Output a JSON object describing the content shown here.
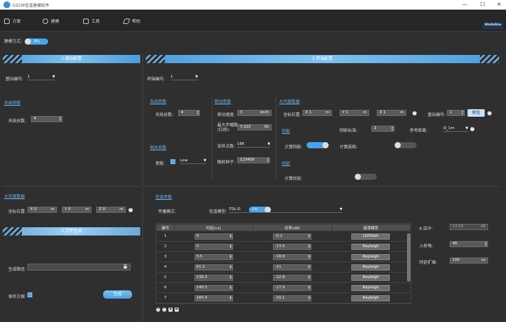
{
  "app": {
    "title": "GSCM信道建模软件"
  },
  "menu": {
    "items": [
      {
        "label": "方案",
        "icon": "document-icon"
      },
      {
        "label": "建模",
        "icon": "model-icon"
      },
      {
        "label": "工具",
        "icon": "toolbox-icon"
      },
      {
        "label": "帮助",
        "icon": "send-icon"
      }
    ],
    "brand": "Statistica"
  },
  "mode": {
    "label": "建模方式:",
    "toggle_text": "默认"
  },
  "base": {
    "header": "1.基站配置",
    "station_label": "基站编号:",
    "station_value": "1",
    "antenna_section": "天线参数",
    "antenna_count_label": "天线总数:",
    "antenna_count_value": "4",
    "scale_section": "大尺度数据",
    "coord_label": "坐标位置:",
    "x_prefix": "X",
    "x_value": "0",
    "y_prefix": "Y",
    "y_value": "0",
    "z_prefix": "Z",
    "z_value": "0",
    "unit_m": "m"
  },
  "terminal": {
    "header": "2.终端配置",
    "terminal_label": "终端编号:",
    "terminal_value": "1",
    "antenna_section": "天线参数",
    "antenna_count_label": "天线总数:",
    "antenna_count_value": "4",
    "corr_section": "相关系数",
    "corr_label": "使能:",
    "corr_level": "Low",
    "move_section": "移动参数",
    "speed_label": "移动速度:",
    "speed_value": "3",
    "speed_unit": "km/h",
    "step_label": "最大步幅数 (位移):",
    "step_value": "7.222",
    "step_unit": "Hz",
    "sample_label": "采样点数:",
    "sample_value": "16K",
    "seed_label": "随机种子:",
    "seed_value": "123456",
    "scale_section": "大尺度数据",
    "coord_label": "坐标位置:",
    "x_prefix": "X",
    "x_value": "1",
    "y_prefix": "Y",
    "y_value": "1",
    "z_prefix": "Z",
    "z_value": "1",
    "unit_m": "m",
    "base_no_label": "基站编号:",
    "base_no_value": "1",
    "preview_button": "预览",
    "shadow_section": "阴影",
    "shadow_calc_label": "计算阴影:",
    "shadow_std_label": "阴影标准:",
    "shadow_std_value": "2",
    "ref_label": "参考距离:",
    "ref_value": "D_1m",
    "pathloss_calc_label": "计算损耗:",
    "timing_section": "时延",
    "timing_calc_label": "计算时延:"
  },
  "file": {
    "header": "3.文件生成",
    "path_label": "生成路径:",
    "save_label": "保存方案:",
    "generate_button": "生成"
  },
  "channel": {
    "section": "信道参数",
    "mode_label": "传播模式:",
    "mode_toggle": "LOS",
    "model_label": "信道模型:",
    "model_value": "TDL-D",
    "columns": [
      "编号",
      "时延(ns)",
      "功率(dB)",
      "衰落模型"
    ],
    "rows": [
      {
        "id": "1",
        "delay": "0",
        "power": "-0.2",
        "fading": "LOSPath"
      },
      {
        "id": "2",
        "delay": "0",
        "power": "-13.5",
        "fading": "Rayleigh"
      },
      {
        "id": "3",
        "delay": "3.5",
        "power": "-18.8",
        "fading": "Rayleigh"
      },
      {
        "id": "4",
        "delay": "61.2",
        "power": "-21",
        "fading": "Rayleigh"
      },
      {
        "id": "5",
        "delay": "136.3",
        "power": "-22.8",
        "fading": "Rayleigh"
      },
      {
        "id": "6",
        "delay": "140.5",
        "power": "-17.9",
        "fading": "Rayleigh"
      },
      {
        "id": "7",
        "delay": "180.4",
        "power": "-20.1",
        "fading": "Rayleigh"
      }
    ],
    "k_label": "K 因子:",
    "k_value": "13.19",
    "k_unit": "dB",
    "angle_label": "入射角:",
    "angle_value": "45",
    "spread_label": "时延扩展:",
    "spread_value": "100",
    "spread_unit": "ns"
  }
}
